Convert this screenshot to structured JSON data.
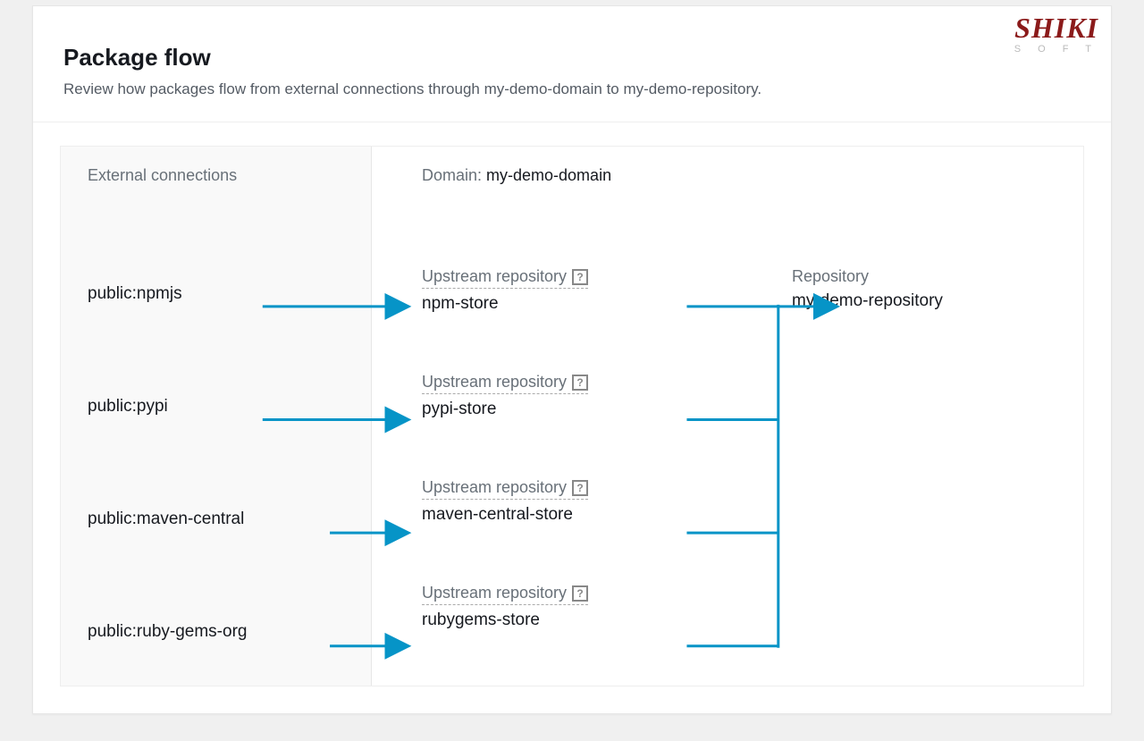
{
  "logo": {
    "main": "SHIKI",
    "sub": "S O F T"
  },
  "header": {
    "title": "Package flow",
    "subtitle": "Review how packages flow from external connections through my-demo-domain to my-demo-repository."
  },
  "columns": {
    "external_header": "External connections",
    "domain_header_label": "Domain: ",
    "domain_header_value": "my-demo-domain",
    "upstream_label": "Upstream repository",
    "repository_label": "Repository",
    "repository_value": "my-demo-repository"
  },
  "rows": [
    {
      "external": "public:npmjs",
      "upstream": "npm-store"
    },
    {
      "external": "public:pypi",
      "upstream": "pypi-store"
    },
    {
      "external": "public:maven-central",
      "upstream": "maven-central-store"
    },
    {
      "external": "public:ruby-gems-org",
      "upstream": "rubygems-store"
    }
  ],
  "colors": {
    "arrow": "#0694c7"
  }
}
